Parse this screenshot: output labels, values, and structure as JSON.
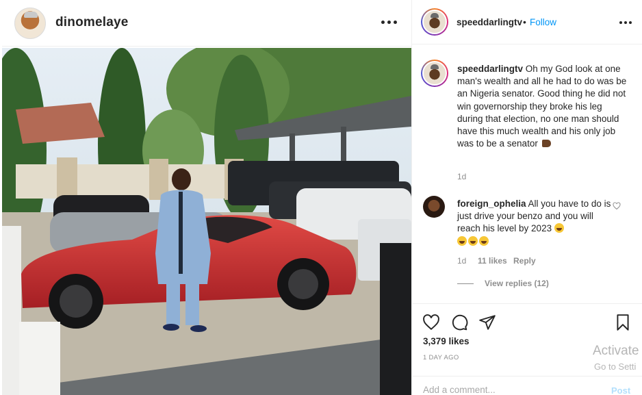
{
  "post_owner": {
    "username": "dinomelaye",
    "avatar_icon": "profile-avatar"
  },
  "right_header": {
    "username": "speeddarlingtv",
    "separator": "•",
    "follow_label": "Follow"
  },
  "caption": {
    "username": "speeddarlingtv",
    "text": "Oh my God look at one man's wealth and all he had to do was be an Nigeria senator. Good thing he did not win governorship they broke his leg during that election, no one man should have this much wealth and his only job was to be a senator",
    "age": "1d"
  },
  "comments": [
    {
      "username": "foreign_ophelia",
      "text": "All you have to do is just drive your benzo and you will reach his level by 2023",
      "age": "1d",
      "likes": "11 likes",
      "reply_label": "Reply",
      "view_replies": "View replies (12)"
    }
  ],
  "engagement": {
    "likes": "3,379 likes",
    "time": "1 DAY AGO"
  },
  "add_comment": {
    "placeholder": "Add a comment...",
    "post_label": "Post"
  },
  "watermark": {
    "line1": "Activate",
    "line2": "Go to Setti"
  },
  "colors": {
    "link_blue": "#0095f6",
    "text": "#262626",
    "muted": "#8e8e8e",
    "car_red": "#c0272d"
  }
}
